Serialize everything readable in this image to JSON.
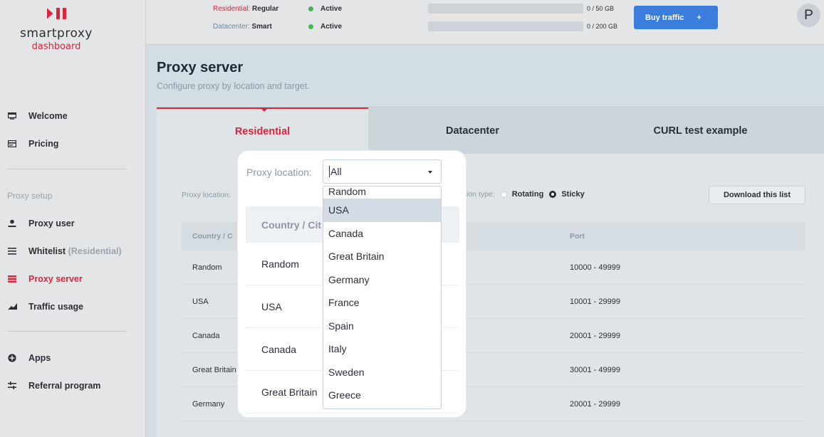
{
  "brand": {
    "name": "smartproxy",
    "sub": "dashboard",
    "accent": "#d7263d"
  },
  "sidebar": {
    "items_top": [
      {
        "label": "Welcome",
        "icon": "monitor-icon"
      },
      {
        "label": "Pricing",
        "icon": "card-icon"
      }
    ],
    "section_label": "Proxy setup",
    "items_setup": [
      {
        "label": "Proxy user",
        "icon": "user-icon",
        "suffix": ""
      },
      {
        "label": "Whitelist",
        "icon": "list-icon",
        "suffix": "(Residential)"
      },
      {
        "label": "Proxy server",
        "icon": "server-icon",
        "suffix": "",
        "active": true
      },
      {
        "label": "Traffic usage",
        "icon": "chart-icon",
        "suffix": ""
      }
    ],
    "items_bottom": [
      {
        "label": "Apps",
        "icon": "apps-icon"
      },
      {
        "label": "Referral program",
        "icon": "exchange-icon"
      }
    ]
  },
  "topbar": {
    "plans": [
      {
        "label": "Residential:",
        "value": "Regular",
        "status": "Active",
        "usage": "0 / 50 GB",
        "progress": 0.0
      },
      {
        "label": "Datacenter:",
        "value": "Smart",
        "status": "Active",
        "usage": "0 / 200 GB",
        "progress": 0.0
      }
    ],
    "buy_label": "Buy traffic",
    "buy_icon": "+",
    "avatar": "P"
  },
  "page": {
    "title": "Proxy server",
    "subtitle": "Configure proxy by location and target."
  },
  "tabs": [
    "Residential",
    "Datacenter",
    "CURL test example"
  ],
  "controls": {
    "location_label": "Proxy location:",
    "location_value": "All",
    "session_label": "ion type:",
    "rotating": "Rotating",
    "sticky": "Sticky",
    "download": "Download this list"
  },
  "table": {
    "headers": [
      "Country / C",
      "",
      "Port"
    ],
    "rows": [
      [
        "Random",
        "",
        "10000 - 49999"
      ],
      [
        "USA",
        "",
        "10001 - 29999"
      ],
      [
        "Canada",
        "",
        "20001 - 29999"
      ],
      [
        "Great Britain",
        "",
        "30001 - 49999"
      ],
      [
        "Germany",
        "",
        "20001 - 29999"
      ]
    ]
  },
  "spotlight": {
    "label": "Proxy location:",
    "header": "Country / Cit",
    "rows": [
      "Random",
      "USA",
      "Canada",
      "Great Britain"
    ]
  },
  "dropdown": {
    "options": [
      "Random",
      "USA",
      "Canada",
      "Great Britain",
      "Germany",
      "France",
      "Spain",
      "Italy",
      "Sweden",
      "Greece"
    ],
    "selected": "USA"
  }
}
